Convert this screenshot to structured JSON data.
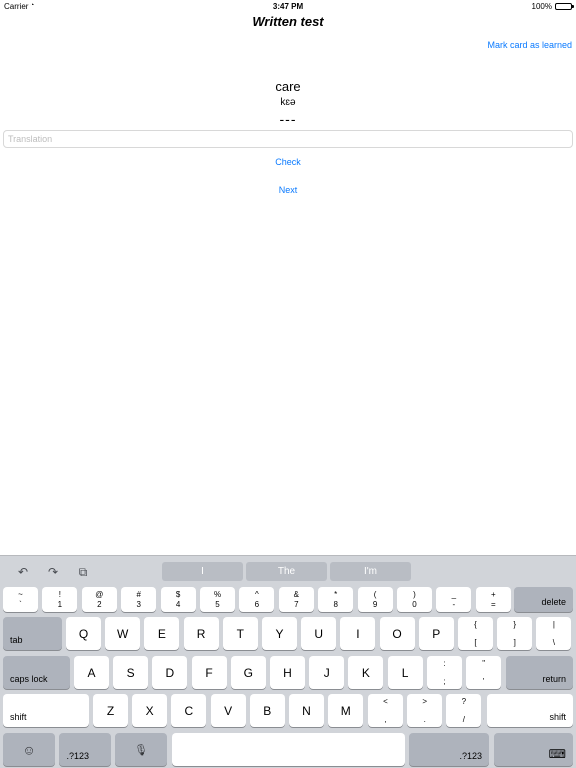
{
  "status": {
    "carrier": "Carrier",
    "time": "3:47 PM",
    "battery": "100%"
  },
  "nav": {
    "title": "Written test",
    "mark_learned": "Mark card as learned"
  },
  "card": {
    "word": "care",
    "phonetic": "kɛə",
    "mask": "---"
  },
  "translation": {
    "placeholder": "Translation",
    "value": ""
  },
  "actions": {
    "check": "Check",
    "next": "Next"
  },
  "keyboard": {
    "suggestions": [
      "I",
      "The",
      "I'm"
    ],
    "tools": {
      "undo": "↶",
      "redo": "↷",
      "paste": "⧉"
    },
    "number_row": [
      {
        "up": "~",
        "dn": "`"
      },
      {
        "up": "!",
        "dn": "1"
      },
      {
        "up": "@",
        "dn": "2"
      },
      {
        "up": "#",
        "dn": "3"
      },
      {
        "up": "$",
        "dn": "4"
      },
      {
        "up": "%",
        "dn": "5"
      },
      {
        "up": "^",
        "dn": "6"
      },
      {
        "up": "&",
        "dn": "7"
      },
      {
        "up": "*",
        "dn": "8"
      },
      {
        "up": "(",
        "dn": "9"
      },
      {
        "up": ")",
        "dn": "0"
      },
      {
        "up": "_",
        "dn": "-"
      },
      {
        "up": "+",
        "dn": "="
      }
    ],
    "delete": "delete",
    "tab": "tab",
    "qwerty_row": [
      "Q",
      "W",
      "E",
      "R",
      "T",
      "Y",
      "U",
      "I",
      "O",
      "P"
    ],
    "bracket_keys": [
      {
        "up": "{",
        "dn": "["
      },
      {
        "up": "}",
        "dn": "]"
      },
      {
        "up": "|",
        "dn": "\\"
      }
    ],
    "caps_lock": "caps lock",
    "asdf_row": [
      "A",
      "S",
      "D",
      "F",
      "G",
      "H",
      "J",
      "K",
      "L"
    ],
    "colon_keys": [
      {
        "up": ":",
        "dn": ";"
      },
      {
        "up": "\"",
        "dn": "'"
      }
    ],
    "return": "return",
    "shift": "shift",
    "zxcv_row": [
      "Z",
      "X",
      "C",
      "V",
      "B",
      "N",
      "M"
    ],
    "punct_keys": [
      {
        "up": "<",
        "dn": ","
      },
      {
        "up": ">",
        "dn": "."
      },
      {
        "up": "?",
        "dn": "/"
      }
    ],
    "numeric": ".?123",
    "emoji": "☺",
    "mic": "🎙",
    "hide": "⌨"
  }
}
